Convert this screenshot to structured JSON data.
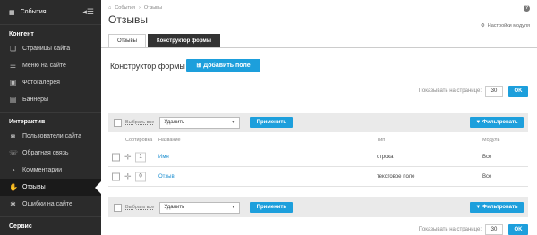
{
  "sidebar": {
    "top_label": "События",
    "sections": [
      {
        "title": "Контент",
        "items": [
          {
            "label": "Страницы сайта",
            "icon": "pages-icon",
            "glyph": "❏"
          },
          {
            "label": "Меню на сайте",
            "icon": "menu-icon",
            "glyph": "☰"
          },
          {
            "label": "Фотогалерея",
            "icon": "gallery-icon",
            "glyph": "▣"
          },
          {
            "label": "Баннеры",
            "icon": "banner-icon",
            "glyph": "▤"
          }
        ]
      },
      {
        "title": "Интерактив",
        "items": [
          {
            "label": "Пользователи сайта",
            "icon": "users-icon",
            "glyph": "◙"
          },
          {
            "label": "Обратная связь",
            "icon": "phone-icon",
            "glyph": "☏"
          },
          {
            "label": "Комментарии",
            "icon": "comment-icon",
            "glyph": "◔"
          },
          {
            "label": "Отзывы",
            "icon": "thumbs-up-icon",
            "glyph": "✋"
          },
          {
            "label": "Ошибки на сайте",
            "icon": "error-icon",
            "glyph": "✱"
          }
        ]
      },
      {
        "title": "Сервис",
        "items": []
      }
    ]
  },
  "breadcrumb": [
    "События",
    "Отзывы"
  ],
  "page_title": "Отзывы",
  "module_settings_label": "Настройки модуля",
  "tabs": [
    {
      "label": "Отзывы",
      "active": false
    },
    {
      "label": "Конструктор формы",
      "active": true
    }
  ],
  "section_title": "Конструктор формы",
  "add_field_label": "Добавить поле",
  "per_page": {
    "label": "Показывать на странице:",
    "value": "30",
    "ok_label": "OK"
  },
  "toolbar": {
    "select_all_label": "Выбрать все",
    "action_value": "Удалить",
    "apply_label": "Применить",
    "filter_label": "Фильтровать"
  },
  "table": {
    "headers": {
      "sort": "Сортировка",
      "name": "Название",
      "type": "Тип",
      "module": "Модуль"
    },
    "rows": [
      {
        "sort": "1",
        "name": "Имя",
        "type": "строка",
        "module": "Все"
      },
      {
        "sort": "0",
        "name": "Отзыв",
        "type": "текстовое поле",
        "module": "Все"
      }
    ]
  },
  "colors": {
    "accent": "#1d9fdc",
    "sidebar_bg": "#2b2b2b",
    "active_tab": "#333333"
  }
}
